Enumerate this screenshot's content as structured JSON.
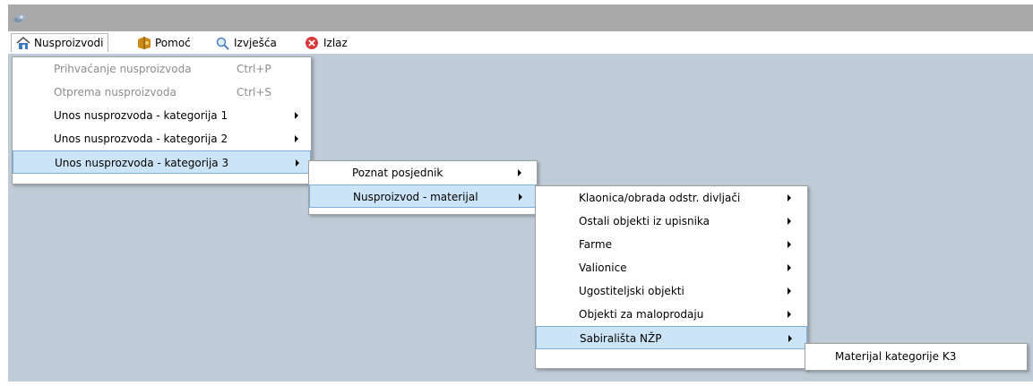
{
  "menubar": {
    "items": [
      {
        "label": "Nusproizvodi",
        "icon": "home-icon"
      },
      {
        "label": "Pomoć",
        "icon": "help-book-icon"
      },
      {
        "label": "Izvješća",
        "icon": "magnifier-icon"
      },
      {
        "label": "Izlaz",
        "icon": "close-red-icon"
      }
    ]
  },
  "menu_nusproizvodi": {
    "items": [
      {
        "label": "Prihvaćanje nusproizvoda",
        "shortcut": "Ctrl+P",
        "enabled": false
      },
      {
        "label": "Otprema nusproizvoda",
        "shortcut": "Ctrl+S",
        "enabled": false
      },
      {
        "label": "Unos nusprozvoda - kategorija 1"
      },
      {
        "label": "Unos nusprozvoda - kategorija 2"
      },
      {
        "label": "Unos nusprozvoda - kategorija 3",
        "highlighted": true
      }
    ]
  },
  "submenu_kategorija3": {
    "items": [
      {
        "label": "Poznat posjednik"
      },
      {
        "label": "Nusproizvod - materijal",
        "highlighted": true
      }
    ]
  },
  "submenu_materijal": {
    "items": [
      {
        "label": "Klaonica/obrada odstr. divljači"
      },
      {
        "label": "Ostali objekti iz upisnika"
      },
      {
        "label": "Farme"
      },
      {
        "label": "Valionice"
      },
      {
        "label": "Ugostiteljski objekti"
      },
      {
        "label": "Objekti za maloprodaju"
      },
      {
        "label": "Sabirališta NŽP",
        "highlighted": true
      }
    ]
  },
  "submenu_sabiralista": {
    "items": [
      {
        "label": "Materijal kategorije K3"
      }
    ]
  },
  "colors": {
    "titlebar": "#a9a9a9",
    "workspace": "#bfcbd6",
    "highlight": "#cce4f7",
    "highlight_border": "#7aaedc",
    "disabled_text": "#8d8d8d"
  }
}
